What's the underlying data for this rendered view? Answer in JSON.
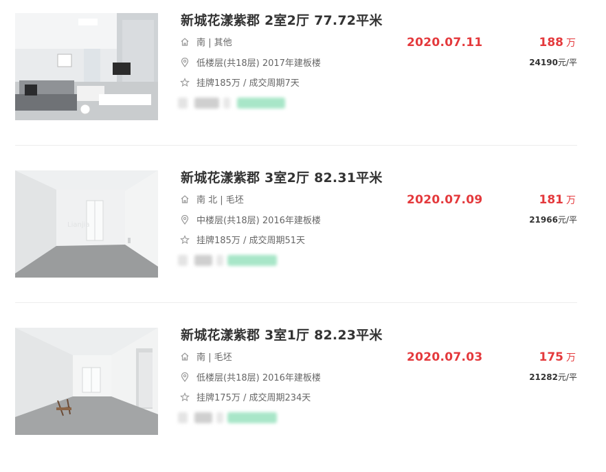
{
  "listings": [
    {
      "title": "新城花漾紫郡 2室2厅 77.72平米",
      "orientation_decor": "南 | 其他",
      "floor_info": "低楼层(共18层) 2017年建板楼",
      "deal_info": "挂牌185万 / 成交周期7天",
      "deal_date": "2020.07.11",
      "total_price": "188",
      "total_price_unit": "万",
      "unit_price_num": "24190",
      "unit_price_unit": "元/平",
      "photo_alt": "living-room-photo"
    },
    {
      "title": "新城花漾紫郡 3室2厅 82.31平米",
      "orientation_decor": "南 北 | 毛坯",
      "floor_info": "中楼层(共18层) 2016年建板楼",
      "deal_info": "挂牌185万 / 成交周期51天",
      "deal_date": "2020.07.09",
      "total_price": "181",
      "total_price_unit": "万",
      "unit_price_num": "21966",
      "unit_price_unit": "元/平",
      "photo_alt": "empty-room-photo"
    },
    {
      "title": "新城花漾紫郡 3室1厅 82.23平米",
      "orientation_decor": "南 | 毛坯",
      "floor_info": "低楼层(共18层) 2016年建板楼",
      "deal_info": "挂牌175万 / 成交周期234天",
      "deal_date": "2020.07.03",
      "total_price": "175",
      "total_price_unit": "万",
      "unit_price_num": "21282",
      "unit_price_unit": "元/平",
      "photo_alt": "empty-room-photo"
    }
  ],
  "colors": {
    "accent_red": "#e4393c",
    "title_text": "#333333",
    "meta_text": "#666666",
    "separator": "#ececec",
    "tag_green": "#9fe0c0"
  },
  "icons": {
    "orientation": "house-icon",
    "floor": "location-pin-icon",
    "deal": "star-icon"
  }
}
